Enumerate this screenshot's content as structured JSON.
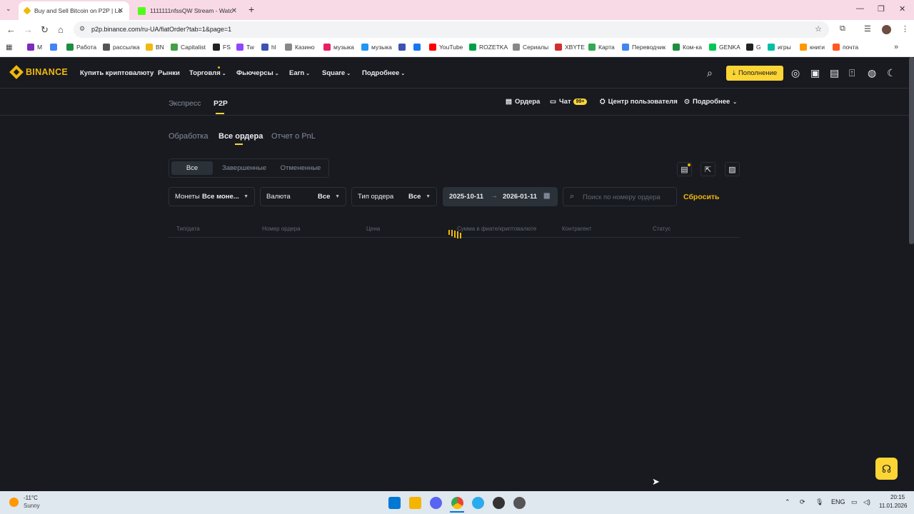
{
  "browser": {
    "tabs": [
      {
        "title": "Buy and Sell Bitcoin on P2P | Lo",
        "active": true
      },
      {
        "title": "1111111nfssQW Stream - Watc",
        "active": false
      }
    ],
    "new_tab": "+",
    "url": "p2p.binance.com/ru-UA/fiatOrder?tab=1&page=1",
    "bookmarks": [
      {
        "label": "M",
        "color": "#7b2cbf"
      },
      {
        "label": "",
        "color": "#4285f4"
      },
      {
        "label": "Работа",
        "color": "#1e8e3e"
      },
      {
        "label": "рассылка",
        "color": "#555555"
      },
      {
        "label": "BN",
        "color": "#f0b90b"
      },
      {
        "label": "Capitalist",
        "color": "#43a047"
      },
      {
        "label": "FS",
        "color": "#222222"
      },
      {
        "label": "Tw",
        "color": "#9146ff"
      },
      {
        "label": "hl",
        "color": "#3f51b5"
      },
      {
        "label": "Казино",
        "color": "#888888"
      },
      {
        "label": "музыка",
        "color": "#e91e63"
      },
      {
        "label": "музыка",
        "color": "#2196f3"
      },
      {
        "label": "",
        "color": "#3f51b5"
      },
      {
        "label": "",
        "color": "#1877f2"
      },
      {
        "label": "YouTube",
        "color": "#ff0000"
      },
      {
        "label": "ROZETKA",
        "color": "#00a046"
      },
      {
        "label": "Сериалы",
        "color": "#888888"
      },
      {
        "label": "XBYTE",
        "color": "#d32f2f"
      },
      {
        "label": "Карта",
        "color": "#34a853"
      },
      {
        "label": "Переводчик",
        "color": "#4285f4"
      },
      {
        "label": "Ком-ка",
        "color": "#1e8e3e"
      },
      {
        "label": "GENKA",
        "color": "#00c853"
      },
      {
        "label": "G",
        "color": "#222222"
      },
      {
        "label": "игры",
        "color": "#00bfa5"
      },
      {
        "label": "книги",
        "color": "#ff9800"
      },
      {
        "label": "почта",
        "color": "#ff5722"
      }
    ]
  },
  "header": {
    "logo": "BINANCE",
    "nav": [
      "Купить криптовалюту",
      "Рынки",
      "Торговля",
      "Фьючерсы",
      "Earn",
      "Square",
      "Подробнее"
    ],
    "deposit": "Пополнение"
  },
  "subheader": {
    "tabs": [
      "Экспресс",
      "P2P"
    ],
    "orders": "Ордера",
    "chat": "Чат",
    "chat_badge": "99+",
    "user_center": "Центр пользователя",
    "more": "Подробнее"
  },
  "orders": {
    "tabs": [
      "Обработка",
      "Все ордера",
      "Отчет о PnL"
    ],
    "segments": [
      "Все",
      "Завершенные",
      "Отмененные"
    ],
    "filters": {
      "coins_label": "Монеты",
      "coins_value": "Все моне...",
      "currency_label": "Валюта",
      "currency_value": "Все",
      "type_label": "Тип ордера",
      "type_value": "Все",
      "date_from": "2025-10-11",
      "date_to": "2026-01-11",
      "search_placeholder": "Поиск по номеру ордера",
      "reset": "Сбросить"
    },
    "columns": [
      "Тип/дата",
      "Номер ордера",
      "Цена",
      "Сумма в фиате/криптовалюте",
      "Контрагент",
      "Статус"
    ]
  },
  "taskbar": {
    "weather_temp": "-11°C",
    "weather_text": "Sunny",
    "lang": "ENG",
    "time": "20:15",
    "date": "11.01.2026"
  }
}
